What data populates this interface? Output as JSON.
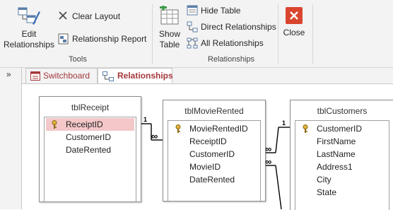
{
  "ribbon": {
    "tools": {
      "edit_relationships": "Edit Relationships",
      "clear_layout": "Clear Layout",
      "relationship_report": "Relationship Report",
      "group_label": "Tools"
    },
    "relationships": {
      "show_table_line1": "Show",
      "show_table_line2": "Table",
      "hide_table": "Hide Table",
      "direct_relationships": "Direct Relationships",
      "all_relationships": "All Relationships",
      "group_label": "Relationships"
    },
    "close": "Close"
  },
  "nav": {
    "collapse_glyph": "»"
  },
  "tabs": [
    {
      "label": "Switchboard"
    },
    {
      "label": "Relationships"
    }
  ],
  "tables": [
    {
      "title": "tblReceipt",
      "fields": [
        "ReceiptID",
        "CustomerID",
        "DateRented"
      ]
    },
    {
      "title": "tblMovieRented",
      "fields": [
        "MovieRentedID",
        "ReceiptID",
        "CustomerID",
        "MovieID",
        "DateRented"
      ]
    },
    {
      "title": "tblCustomers",
      "fields": [
        "CustomerID",
        "FirstName",
        "LastName",
        "Address1",
        "City",
        "State"
      ]
    }
  ],
  "relation_labels": {
    "one": "1",
    "many": "∞"
  },
  "colors": {
    "tab_text": "#a4373a",
    "selected_field": "#f4c7c9",
    "close_red": "#d9452f"
  }
}
